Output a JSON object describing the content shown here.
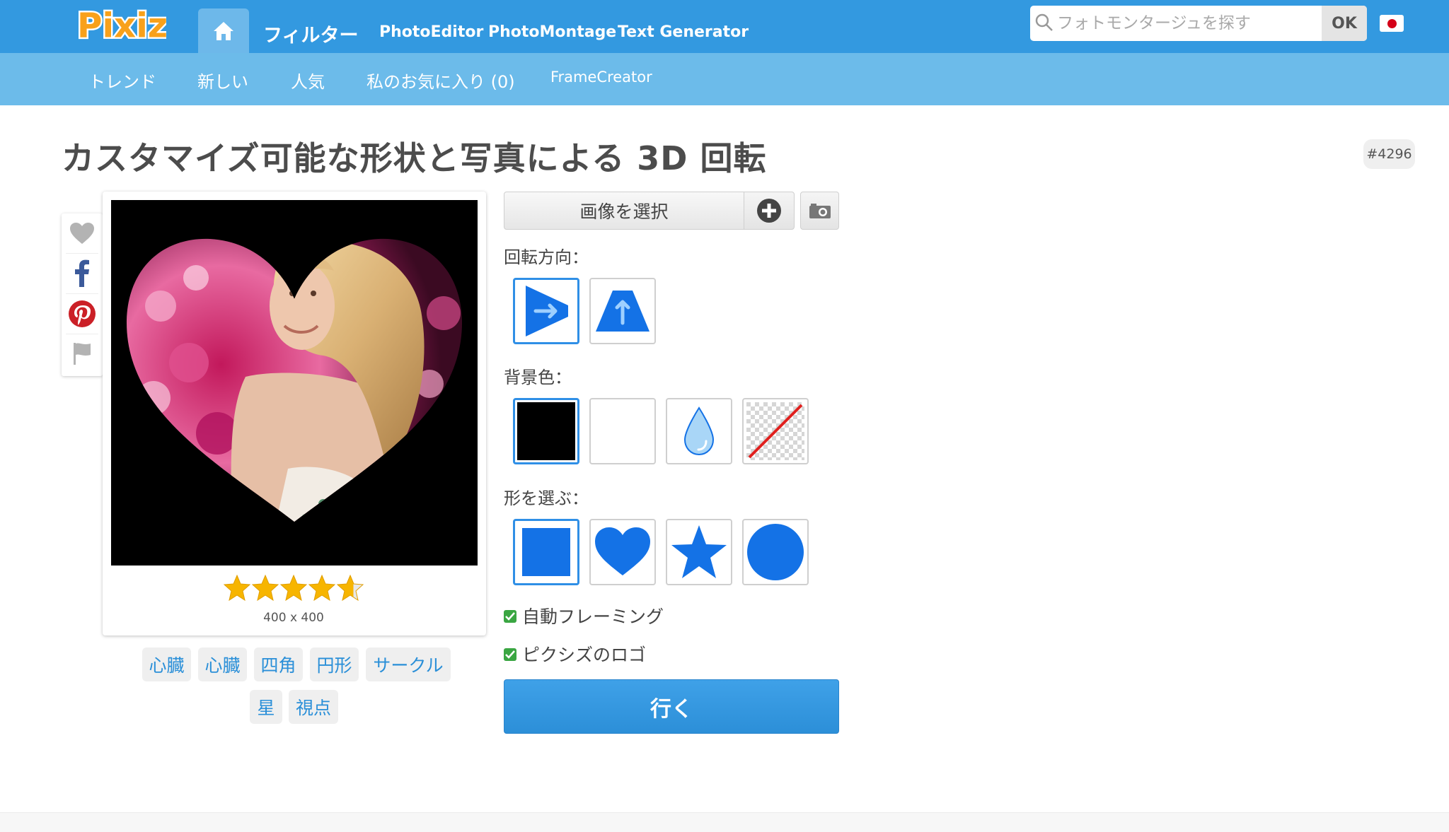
{
  "header": {
    "logo_text": "Pixiz",
    "nav": [
      "フィルター",
      "PhotoEditor",
      "PhotoMontage",
      "Text Generator"
    ],
    "search_placeholder": "フォトモンタージュを探す",
    "search_button": "OK"
  },
  "subnav": [
    "トレンド",
    "新しい",
    "人気",
    "私のお気に入り (0)",
    "FrameCreator"
  ],
  "page": {
    "title": "カスタマイズ可能な形状と写真による 3D 回転",
    "id": "#4296"
  },
  "preview": {
    "dimensions": "400 x 400",
    "rating": 4.5
  },
  "tags": [
    "心臓",
    "心臓",
    "四角",
    "円形",
    "サークル",
    "星",
    "視点"
  ],
  "controls": {
    "choose_image": "画像を選択",
    "rotation_label": "回転方向：",
    "background_label": "背景色：",
    "shape_label": "形を選ぶ：",
    "auto_framing": "自動フレーミング",
    "pixiz_logo": "ピクシズのロゴ",
    "go": "行く"
  },
  "colors": {
    "header": "#3399e0",
    "subheader": "#6cbbea",
    "accent": "#1472e6",
    "star": "#f7b500"
  }
}
